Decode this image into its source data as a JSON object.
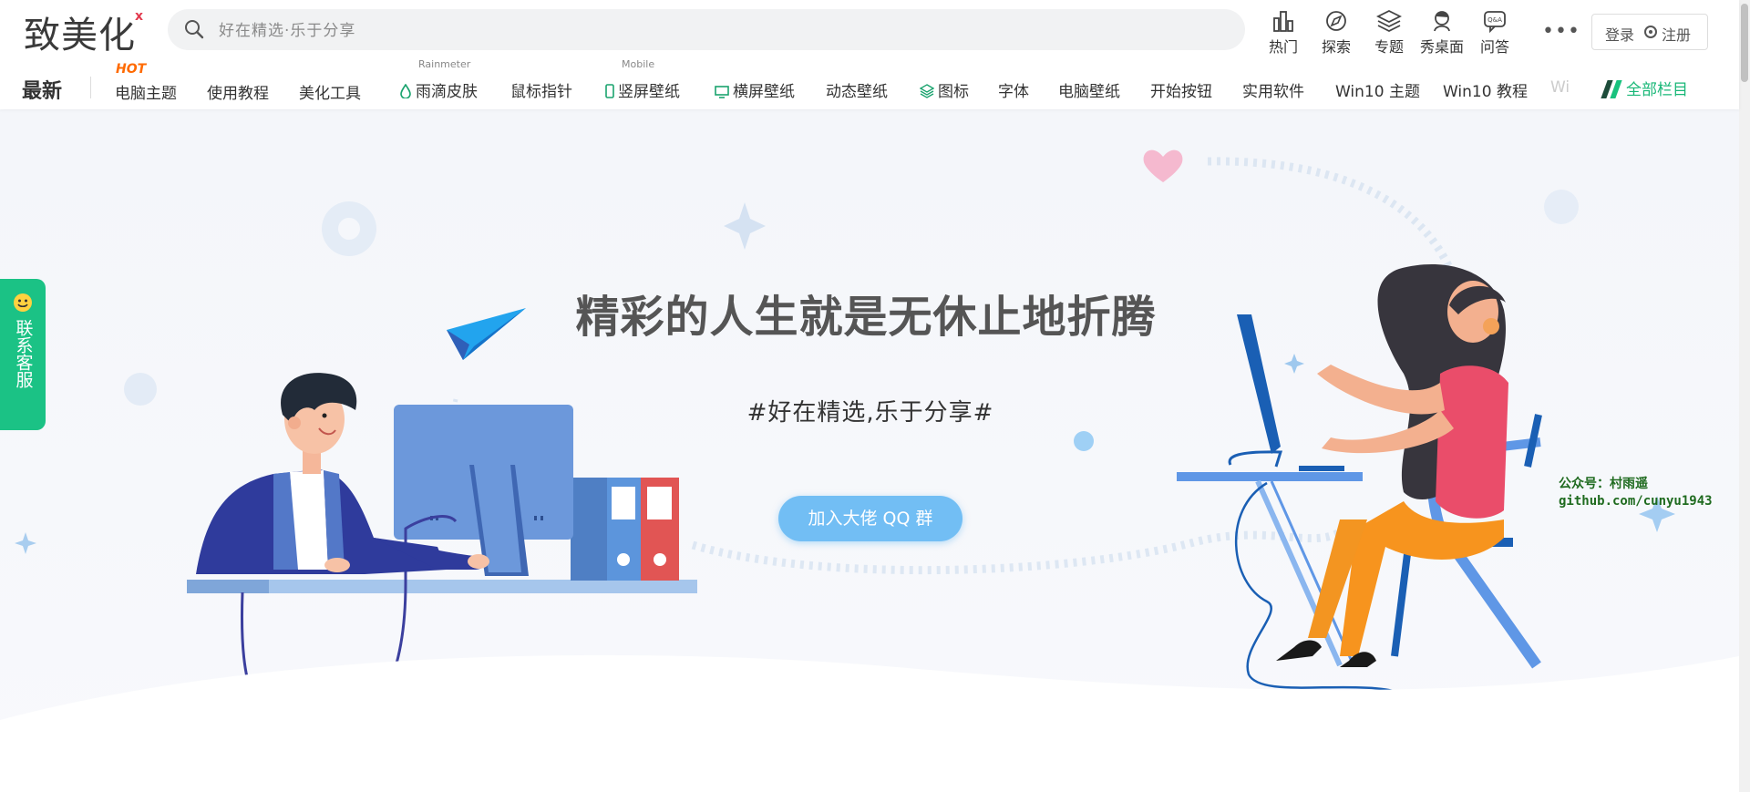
{
  "logo": {
    "text": "致美化",
    "x_mark": "x"
  },
  "search": {
    "placeholder": "好在精选·乐于分享"
  },
  "top_nav": [
    "热门",
    "探索",
    "专题",
    "秀桌面",
    "问答"
  ],
  "more": "•••",
  "auth": {
    "login": "登录",
    "register": "注册"
  },
  "categories": {
    "latest": "最新",
    "hot_tag": "HOT",
    "items": [
      "电脑主题",
      "使用教程",
      "美化工具",
      "雨滴皮肤",
      "鼠标指针",
      "竖屏壁纸",
      "横屏壁纸",
      "动态壁纸",
      "图标",
      "字体",
      "电脑壁纸",
      "开始按钮",
      "实用软件",
      "Win10 主题",
      "Win10 教程",
      "Wi"
    ],
    "sup_rainmeter": "Rainmeter",
    "sup_mobile": "Mobile",
    "all": "全部栏目"
  },
  "hero": {
    "headline": "精彩的人生就是无休止地折腾",
    "subline": "#好在精选,乐于分享#",
    "button": "加入大佬 QQ 群"
  },
  "side_service": "联系客服",
  "watermark": {
    "line1": "公众号：村雨遥",
    "line2": "github.com/cunyu1943"
  },
  "colors": {
    "accent": "#1bc285",
    "button": "#72bef4",
    "hot": "#ff6a00"
  }
}
